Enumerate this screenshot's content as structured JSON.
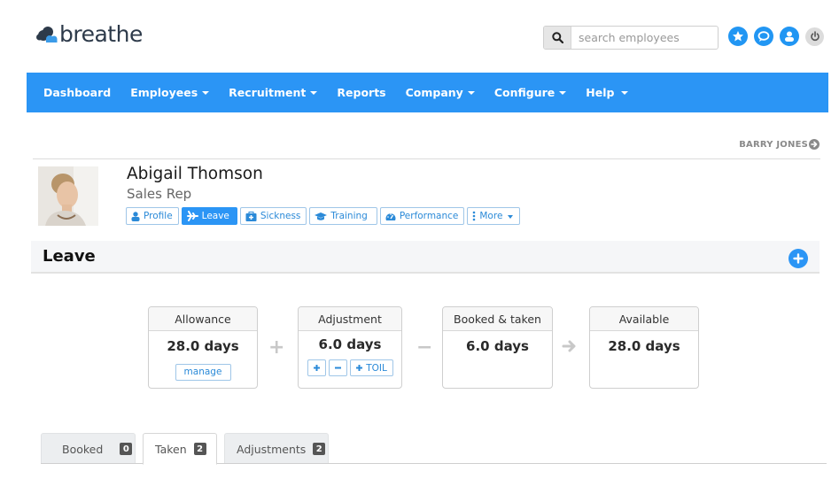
{
  "brand": {
    "name": "breathe",
    "accent": "#2b95f5"
  },
  "search": {
    "placeholder": "search employees",
    "value": ""
  },
  "top_icons": [
    "star-icon",
    "chat-icon",
    "user-icon",
    "power-icon"
  ],
  "nav": {
    "items": [
      {
        "label": "Dashboard",
        "dropdown": false
      },
      {
        "label": "Employees",
        "dropdown": true
      },
      {
        "label": "Recruitment",
        "dropdown": true
      },
      {
        "label": "Reports",
        "dropdown": false
      },
      {
        "label": "Company",
        "dropdown": true
      },
      {
        "label": "Configure",
        "dropdown": true
      },
      {
        "label": "Help",
        "dropdown": true
      }
    ]
  },
  "current_user": {
    "name": "BARRY JONES"
  },
  "employee": {
    "name": "Abigail Thomson",
    "role": "Sales Rep",
    "tabs": [
      {
        "label": "Profile",
        "icon": "user-icon",
        "active": false
      },
      {
        "label": "Leave",
        "icon": "plane-icon",
        "active": true
      },
      {
        "label": "Sickness",
        "icon": "medkit-icon",
        "active": false
      },
      {
        "label": "Training",
        "icon": "graduation-cap-icon",
        "active": false
      },
      {
        "label": "Performance",
        "icon": "dashboard-icon",
        "active": false
      },
      {
        "label": "More",
        "icon": "vertical-ellipsis-icon",
        "active": false,
        "dropdown": true
      }
    ]
  },
  "section": {
    "title": "Leave"
  },
  "summary": {
    "allowance": {
      "label": "Allowance",
      "value": "28.0 days",
      "button": "manage"
    },
    "adjustment": {
      "label": "Adjustment",
      "value": "6.0 days",
      "buttons": [
        "+",
        "−",
        "TOIL"
      ]
    },
    "booked_taken": {
      "label": "Booked & taken",
      "value": "6.0 days"
    },
    "available": {
      "label": "Available",
      "value": "28.0 days"
    }
  },
  "list_tabs": [
    {
      "label": "Booked",
      "count": "0",
      "active": false
    },
    {
      "label": "Taken",
      "count": "2",
      "active": true
    },
    {
      "label": "Adjustments",
      "count": "2",
      "active": false
    }
  ]
}
